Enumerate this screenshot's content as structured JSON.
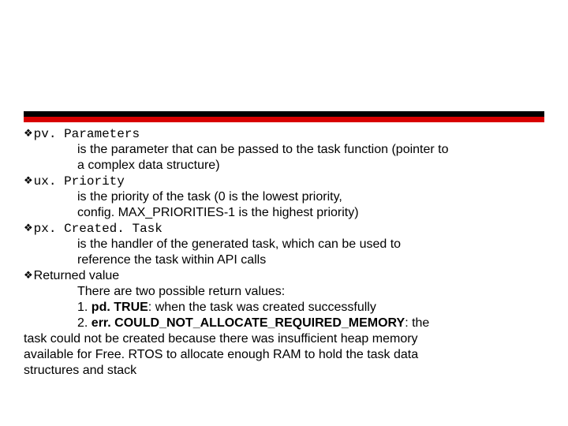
{
  "items": [
    {
      "name": "pv. Parameters",
      "desc_lines": [
        "is the parameter that can be passed to the task function (pointer to",
        "a complex data structure)"
      ]
    },
    {
      "name": "ux. Priority",
      "desc_lines": [
        "is the priority of the task (0 is the lowest priority,",
        "config. MAX_PRIORITIES-1 is the highest priority)"
      ]
    },
    {
      "name": "px. Created. Task",
      "desc_lines": [
        "is the handler of the generated task, which can be used to",
        "reference the task within API calls"
      ]
    }
  ],
  "returned": {
    "label": "Returned value",
    "intro": "There are two possible return values:",
    "one_prefix": "1. ",
    "one_bold": "pd. TRUE",
    "one_rest": ": when the task was created successfully",
    "two_prefix": "2. ",
    "two_bold": "err. COULD_NOT_ALLOCATE_REQUIRED_MEMORY",
    "two_rest": ": the",
    "tail1": "task could not be created because there was insufficient heap memory",
    "tail2": "available for Free. RTOS to allocate enough RAM to hold the task data",
    "tail3": "structures and stack"
  }
}
